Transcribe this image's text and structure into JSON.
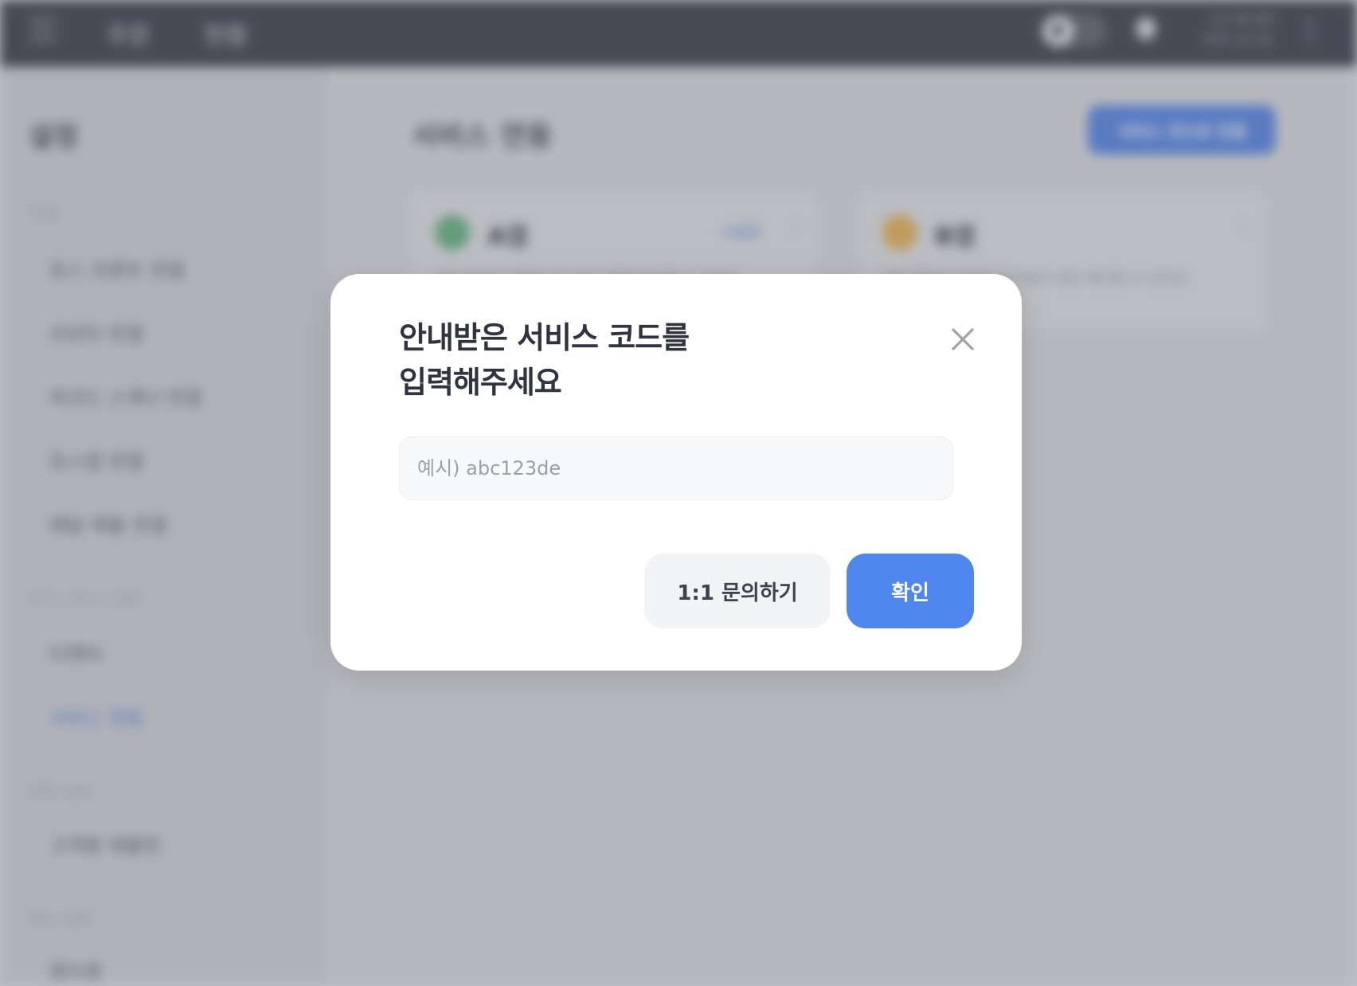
{
  "topbar": {
    "nav": [
      "주문",
      "현황"
    ],
    "clock_time": "12:26:00",
    "clock_date": "오후 12:52"
  },
  "sidebar": {
    "title": "설정",
    "sections": [
      {
        "label": "연결",
        "items": [
          "토스 프론트 연결",
          "프린터 연결",
          "바코드 스캐너 연결",
          "토스앱 연결",
          "배달 매출 연결"
        ]
      },
      {
        "label": "부가 서비스 설정",
        "items": [
          "티켓터",
          "서비스 연동"
        ]
      },
      {
        "label": "화면 설정",
        "items": [
          "고객용 태블릿"
        ]
      },
      {
        "label": "메뉴 설정",
        "items": [
          "영수증"
        ]
      }
    ],
    "active_item": "서비스 연동"
  },
  "main": {
    "title": "서비스 연동",
    "connect_button": "서비스 코드로 연결",
    "cards": [
      {
        "name": "A앱",
        "status": "사용중",
        "desc": "A앱 주문과 매출을 포스에서 함께 관리할 수 있어요",
        "icon": "leaf-icon"
      },
      {
        "name": "B앱",
        "status": "",
        "desc": "B앱 예약과 주문을 포스에서 바로 확인할 수 있어요",
        "icon": "coin-icon"
      }
    ]
  },
  "modal": {
    "title": "안내받은 서비스 코드를\n입력해주세요",
    "input_placeholder": "예시) abc123de",
    "input_value": "",
    "secondary_button": "1:1 문의하기",
    "primary_button": "확인",
    "colors": {
      "primary": "#4f87ee",
      "secondary_bg": "#f3f4f6",
      "title": "#2f3440"
    }
  }
}
